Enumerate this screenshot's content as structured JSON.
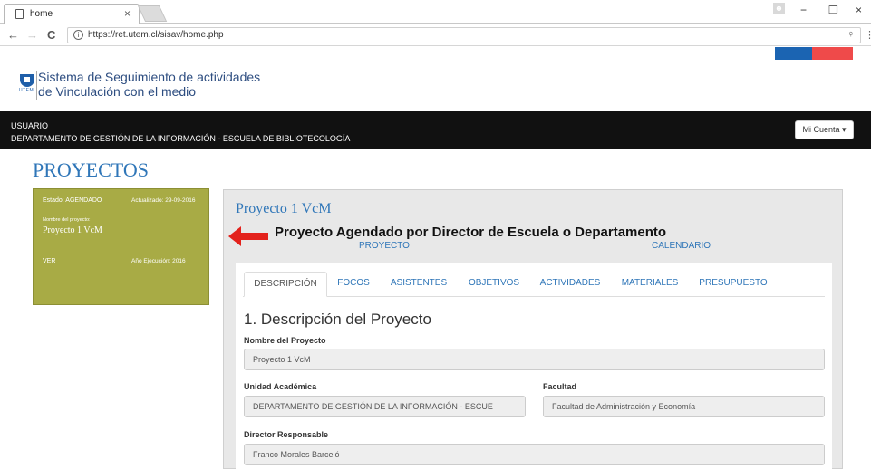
{
  "browser": {
    "tab_title": "home",
    "tab_close": "×",
    "url": "https://ret.utem.cl/sisav/home.php",
    "back": "←",
    "forward": "→",
    "reload": "C",
    "info": "i",
    "extension": "♀",
    "menu": "⋮",
    "minimize": "−",
    "restore": "❐",
    "close": "×"
  },
  "site": {
    "logo_text": "UTEM",
    "brand_line1": "Sistema de Seguimiento de actividades",
    "brand_line2": "de Vinculación con el medio",
    "flag_colors": [
      "#1b64b2",
      "#ef4a4a"
    ]
  },
  "userbar": {
    "role": "USUARIO",
    "department": "DEPARTAMENTO DE GESTIÓN DE LA INFORMACIÓN - ESCUELA DE BIBLIOTECOLOGÍA",
    "account_button": "Mi Cuenta ▾"
  },
  "page_title": "PROYECTOS",
  "card": {
    "estado": "Estado: AGENDADO",
    "actualizado": "Actualizado: 29-09-2016",
    "nombre_label": "Nombre del proyecto:",
    "nombre": "Proyecto 1 VcM",
    "ver": "VER",
    "anio": "Año Ejecución: 2016",
    "color": "#a8ab45"
  },
  "panel": {
    "title": "Proyecto 1 VcM",
    "callout": "Proyecto Agendado por Director de Escuela o Departamento",
    "link_proyecto": "PROYECTO",
    "link_calendario": "CALENDARIO"
  },
  "tabs": [
    "DESCRIPCIÓN",
    "FOCOS",
    "ASISTENTES",
    "OBJETIVOS",
    "ACTIVIDADES",
    "MATERIALES",
    "PRESUPUESTO"
  ],
  "form": {
    "section_title": "1. Descripción del Proyecto",
    "nombre_label": "Nombre del Proyecto",
    "nombre_value": "Proyecto 1 VcM",
    "unidad_label": "Unidad Académica",
    "unidad_value": "DEPARTAMENTO DE GESTIÓN DE LA INFORMACIÓN - ESCUE",
    "facultad_label": "Facultad",
    "facultad_value": "Facultad de Administración y Economía",
    "director_label": "Director Responsable",
    "director_value": "Franco Morales Barceló"
  }
}
